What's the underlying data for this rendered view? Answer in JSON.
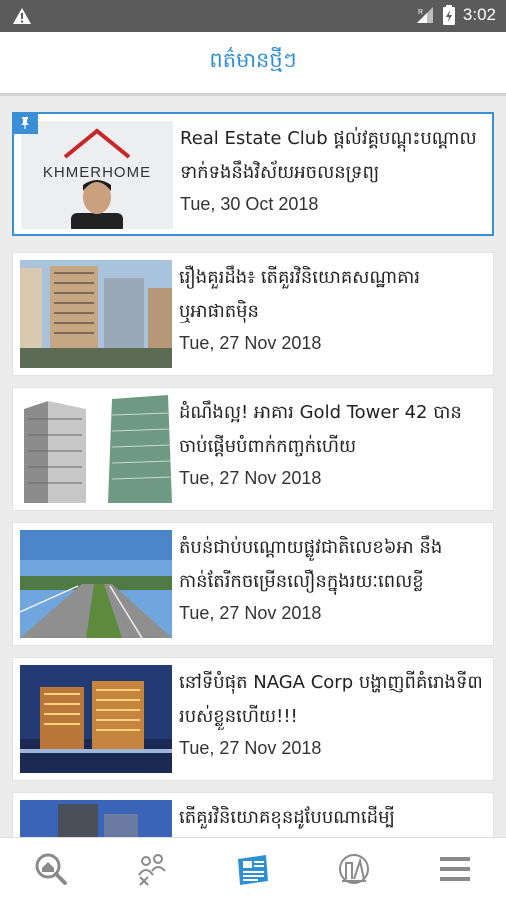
{
  "status_bar": {
    "time": "3:02",
    "icons": [
      "warning-icon",
      "signal-icon",
      "battery-icon"
    ]
  },
  "header": {
    "title": "ពត៌មានថ្មីៗ"
  },
  "articles": [
    {
      "headline": "Real Estate Club ផ្តល់វគ្គបណ្តុះបណ្តាលទាក់ទងនឹងវិស័យអចលនទ្រព្យ",
      "date": "Tue, 30 Oct 2018",
      "thumb_text": "KHMERHOME",
      "pinned": true
    },
    {
      "headline": "រឿងគួរដឹង៖ តើគួរវិនិយោគសណ្ឋាគារ ឬអាផាតម៉ិន",
      "date": "Tue, 27 Nov 2018"
    },
    {
      "headline": "ដំណឹងល្អ! អាគារ Gold Tower 42 បានចាប់ផ្តើមបំពាក់កញ្ចក់ហើយ",
      "date": "Tue, 27 Nov 2018"
    },
    {
      "headline": "តំបន់ជាប់បណ្តោយផ្លូវជាតិលេខ៦អា នឹងកាន់តែរីកចម្រើនលឿនក្នុងរយៈពេលខ្លី",
      "date": "Tue, 27 Nov 2018"
    },
    {
      "headline": "នៅទីបំផុត NAGA Corp បង្ហាញពីគំរោងទី៣ របស់ខ្លួនហើយ!!!",
      "date": "Tue, 27 Nov 2018"
    },
    {
      "headline": "តើគួរវិនិយោគខុនដូបែបណាដើម្បី",
      "date": ""
    }
  ],
  "bottom_nav": {
    "active": "news",
    "accent_color": "#2d8fd4",
    "inactive_color": "#8a8a8a",
    "items": [
      "search-property-icon",
      "agent-icon",
      "news-icon",
      "calculator-icon",
      "menu-icon"
    ]
  }
}
